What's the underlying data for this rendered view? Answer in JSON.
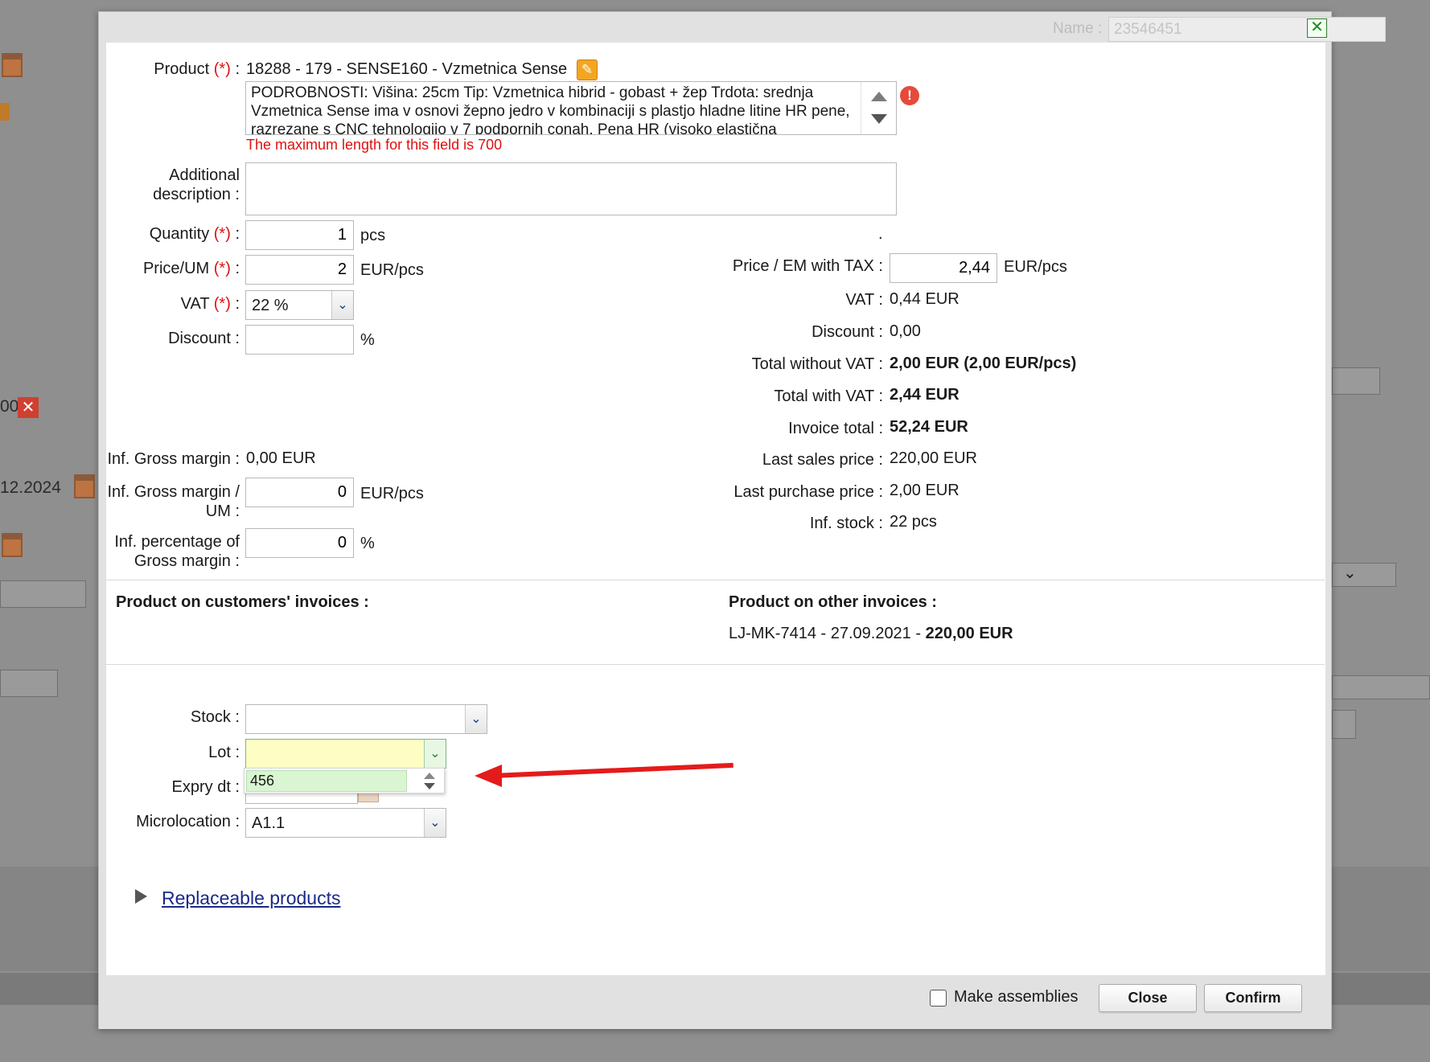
{
  "background": {
    "left_values": [
      "00",
      "12.2024"
    ]
  },
  "dialog": {
    "name_label": "Name :",
    "name_value": "23546451",
    "close_icon": "close-x-icon"
  },
  "product": {
    "label": "Product",
    "required": "(*)",
    "colon": ":",
    "value": "18288 - 179 - SENSE160 - Vzmetnica Sense",
    "description": "PODROBNOSTI: Višina: 25cm Tip: Vzmetnica hibrid - gobast + žep Trdota: srednja Vzmetnica Sense ima v osnovi žepno jedro v kombinaciji s plastjo hladne litine HR pene, razrezane s CNC tehnologijo v 7 podpornih conah. Pena HR (visoko elastična",
    "error_message": "The maximum length for this field is 700"
  },
  "additional_description": {
    "label_line1": "Additional",
    "label_line2": "description :"
  },
  "left": {
    "quantity_label": "Quantity",
    "quantity_value": "1",
    "quantity_unit": "pcs",
    "price_label": "Price/UM",
    "price_value": "2",
    "price_unit": "EUR/pcs",
    "vat_label": "VAT",
    "vat_value": "22 %",
    "discount_label": "Discount :",
    "discount_value": "",
    "discount_unit": "%",
    "gross_margin_label": "Inf. Gross margin :",
    "gross_margin_value": "0,00 EUR",
    "gross_margin_um_label_1": "Inf. Gross margin /",
    "gross_margin_um_label_2": "UM :",
    "gross_margin_um_value": "0",
    "gross_margin_um_unit": "EUR/pcs",
    "gross_pct_label_1": "Inf. percentage of",
    "gross_pct_label_2": "Gross margin :",
    "gross_pct_value": "0",
    "gross_pct_unit": "%"
  },
  "right": {
    "dot": ".",
    "price_tax_label": "Price / EM with TAX :",
    "price_tax_value": "2,44",
    "price_tax_unit": "EUR/pcs",
    "vat_label": "VAT :",
    "vat_value": "0,44 EUR",
    "discount_label": "Discount :",
    "discount_value": "0,00",
    "total_wo_vat_label": "Total without VAT :",
    "total_wo_vat_value": "2,00 EUR (2,00 EUR/pcs)",
    "total_w_vat_label": "Total with VAT :",
    "total_w_vat_value": "2,44 EUR",
    "invoice_total_label": "Invoice total :",
    "invoice_total_value": "52,24 EUR",
    "last_sales_label": "Last sales price :",
    "last_sales_value": "220,00 EUR",
    "last_purchase_label": "Last purchase price :",
    "last_purchase_value": "2,00 EUR",
    "stock_label": "Inf. stock :",
    "stock_value": "22 pcs"
  },
  "invoices": {
    "customers_heading": "Product on customers' invoices :",
    "other_heading": "Product on other invoices :",
    "other_entry_prefix": "LJ-MK-7414 - 27.09.2021 - ",
    "other_entry_amount": "220,00 EUR"
  },
  "stock_section": {
    "stock_label": "Stock :",
    "stock_value": "",
    "lot_label": "Lot :",
    "lot_value": "",
    "lot_options": [
      "456"
    ],
    "expiry_label": "Expry dt :",
    "microlocation_label": "Microlocation :",
    "microlocation_value": "A1.1"
  },
  "replaceable_link": "Replaceable products",
  "footer": {
    "make_assemblies_label": "Make assemblies",
    "make_assemblies_checked": false,
    "close_button": "Close",
    "confirm_button": "Confirm"
  },
  "colors": {
    "required": "#e01010",
    "annotation_arrow": "#e41b1b",
    "lot_highlight": "#fdfdc4",
    "dropdown_item": "#d9f5d2"
  }
}
